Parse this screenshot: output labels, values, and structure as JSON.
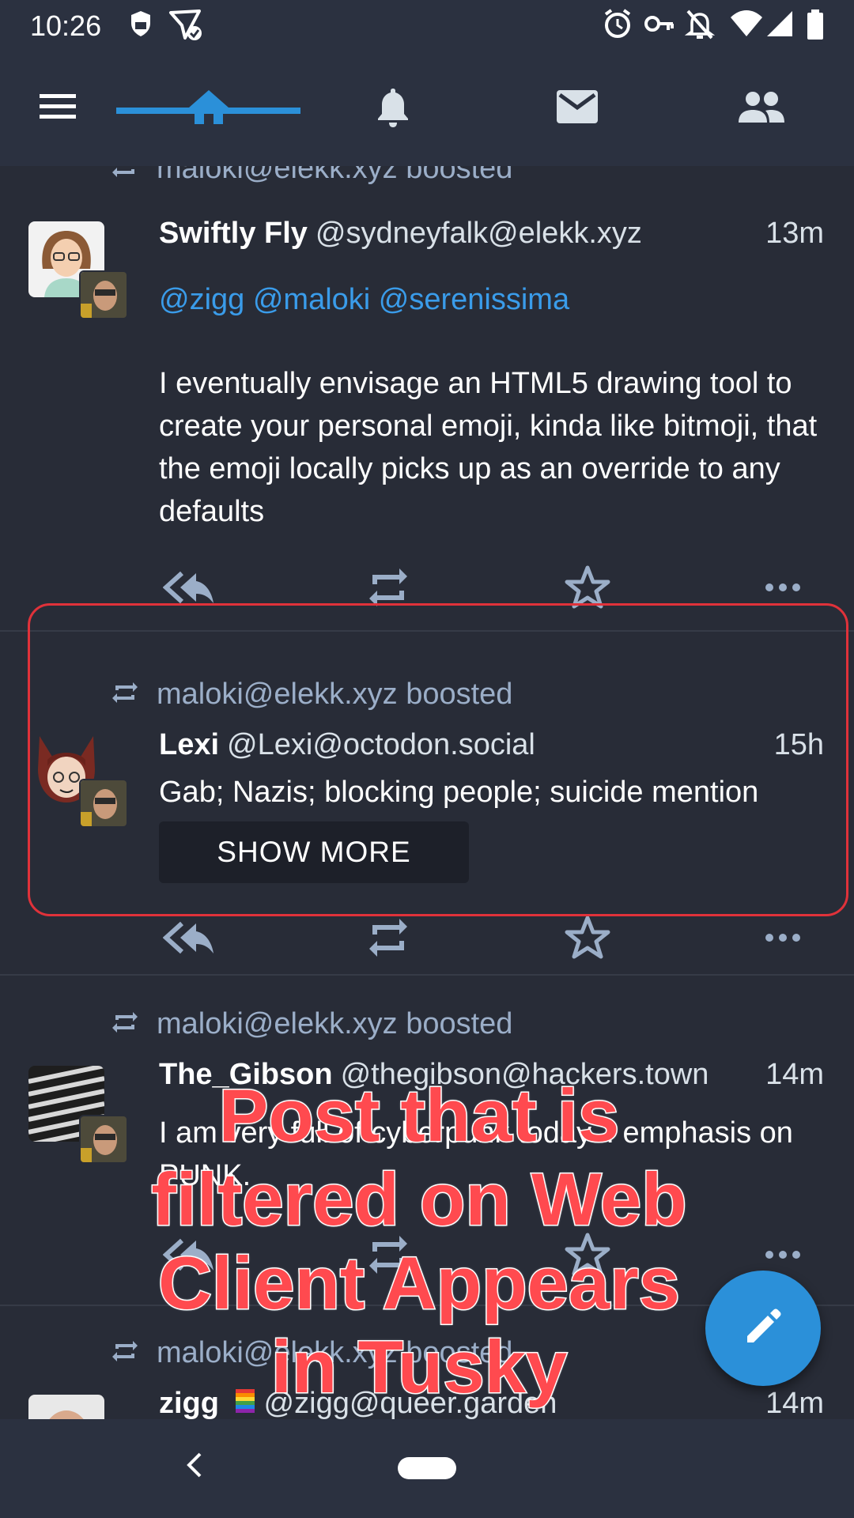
{
  "status_bar": {
    "time": "10:26"
  },
  "tabs": [
    {
      "name": "menu"
    },
    {
      "name": "home",
      "selected": true
    },
    {
      "name": "notifications"
    },
    {
      "name": "direct-messages"
    },
    {
      "name": "lists"
    }
  ],
  "colors": {
    "accent": "#2b90d9",
    "background": "#282c37",
    "bar": "#2b3140",
    "mention": "#3a9cea",
    "secondary_text": "#9baec8",
    "highlight": "#e0323a"
  },
  "statuses": [
    {
      "boosted_by": "maloki@elekk.xyz boosted",
      "display_name": "Swiftly Fly",
      "account": "@sydneyfalk@elekk.xyz",
      "time": "13m",
      "mentions": "@zigg @maloki @serenissima",
      "content": "I eventually envisage an HTML5 drawing tool to create your personal emoji, kinda like bitmoji, that the emoji locally picks up as an override to any defaults"
    },
    {
      "boosted_by": "maloki@elekk.xyz boosted",
      "display_name": "Lexi",
      "account": "@Lexi@octodon.social",
      "time": "15h",
      "content_warning": "Gab; Nazis; blocking people; suicide mention",
      "show_more_label": "SHOW MORE"
    },
    {
      "boosted_by": "maloki@elekk.xyz boosted",
      "display_name": "The_Gibson",
      "account": "@thegibson@hackers.town",
      "time": "14m",
      "content": "I am very full of cyberpunk today... emphasis on PUNK."
    },
    {
      "boosted_by": "maloki@elekk.xyz boosted",
      "display_name": "zigg",
      "account": "@zigg@queer.garden",
      "time": "14m"
    }
  ],
  "overlay_caption": "Post that is filtered on Web Client Appears in Tusky"
}
